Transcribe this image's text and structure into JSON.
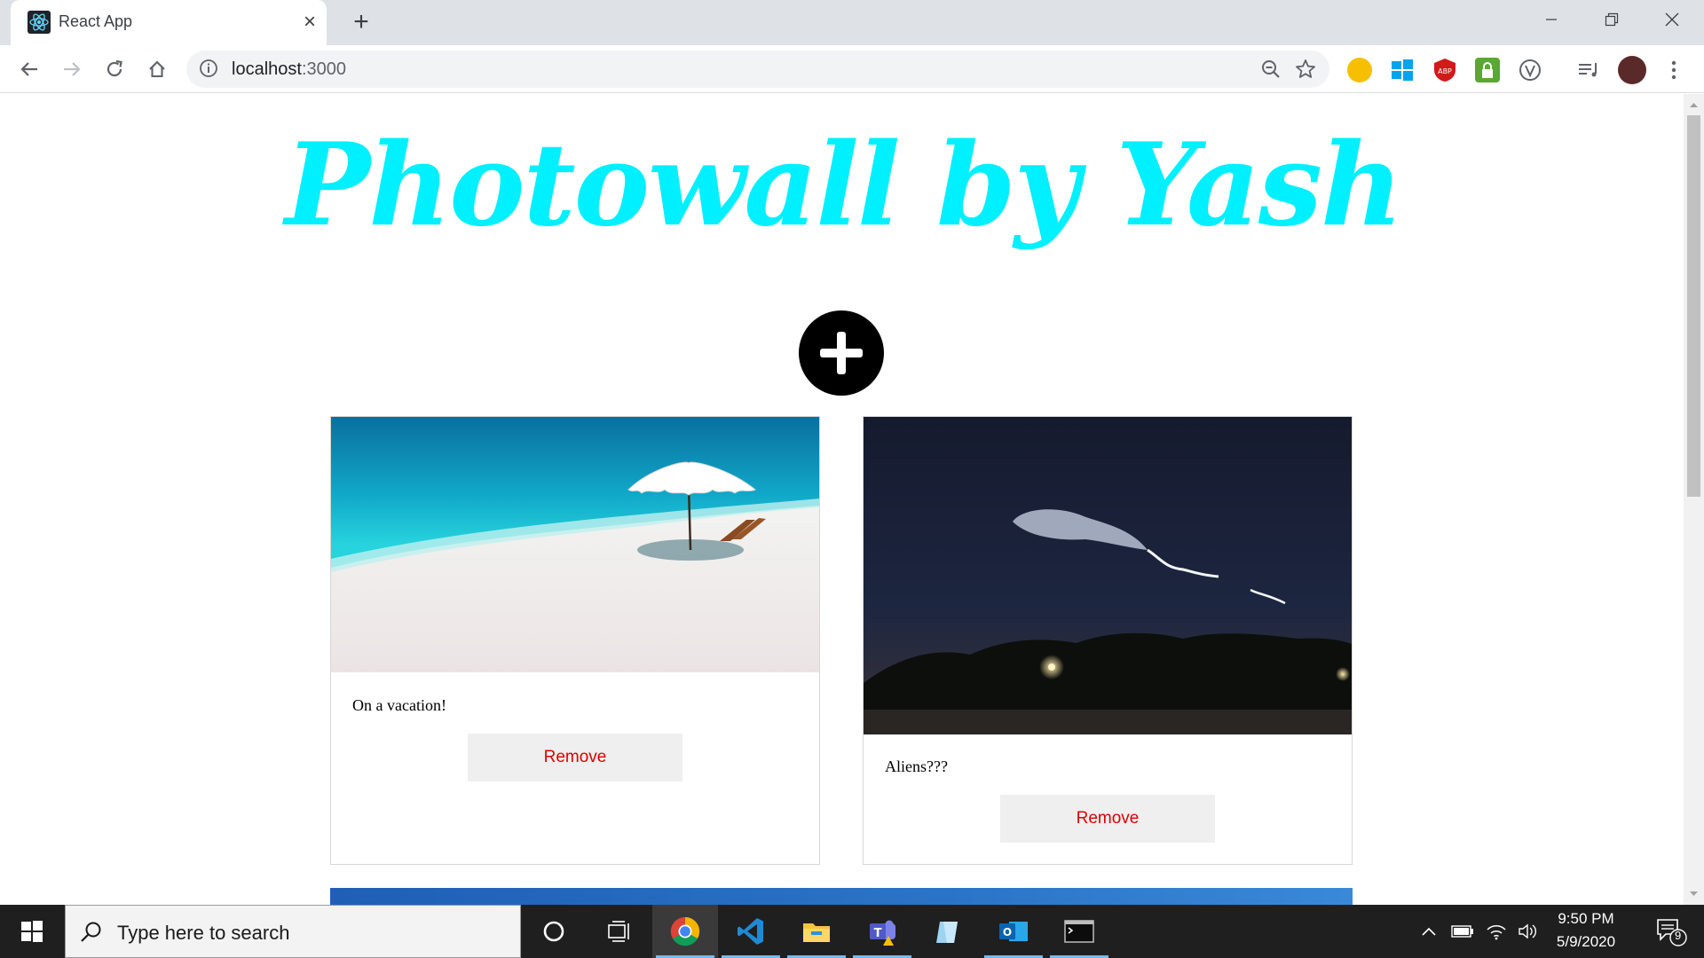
{
  "browser": {
    "tab_title": "React App",
    "url_host": "localhost",
    "url_port": ":3000"
  },
  "page": {
    "title": "Photowall by Yash",
    "posts": [
      {
        "caption": "On a vacation!",
        "remove_label": "Remove"
      },
      {
        "caption": "Aliens???",
        "remove_label": "Remove"
      }
    ]
  },
  "taskbar": {
    "search_placeholder": "Type here to search",
    "time": "9:50 PM",
    "date": "5/9/2020",
    "notification_count": "9"
  },
  "colors": {
    "title": "#00f0ff",
    "remove_text": "#e00000",
    "add_button": "#000000"
  }
}
